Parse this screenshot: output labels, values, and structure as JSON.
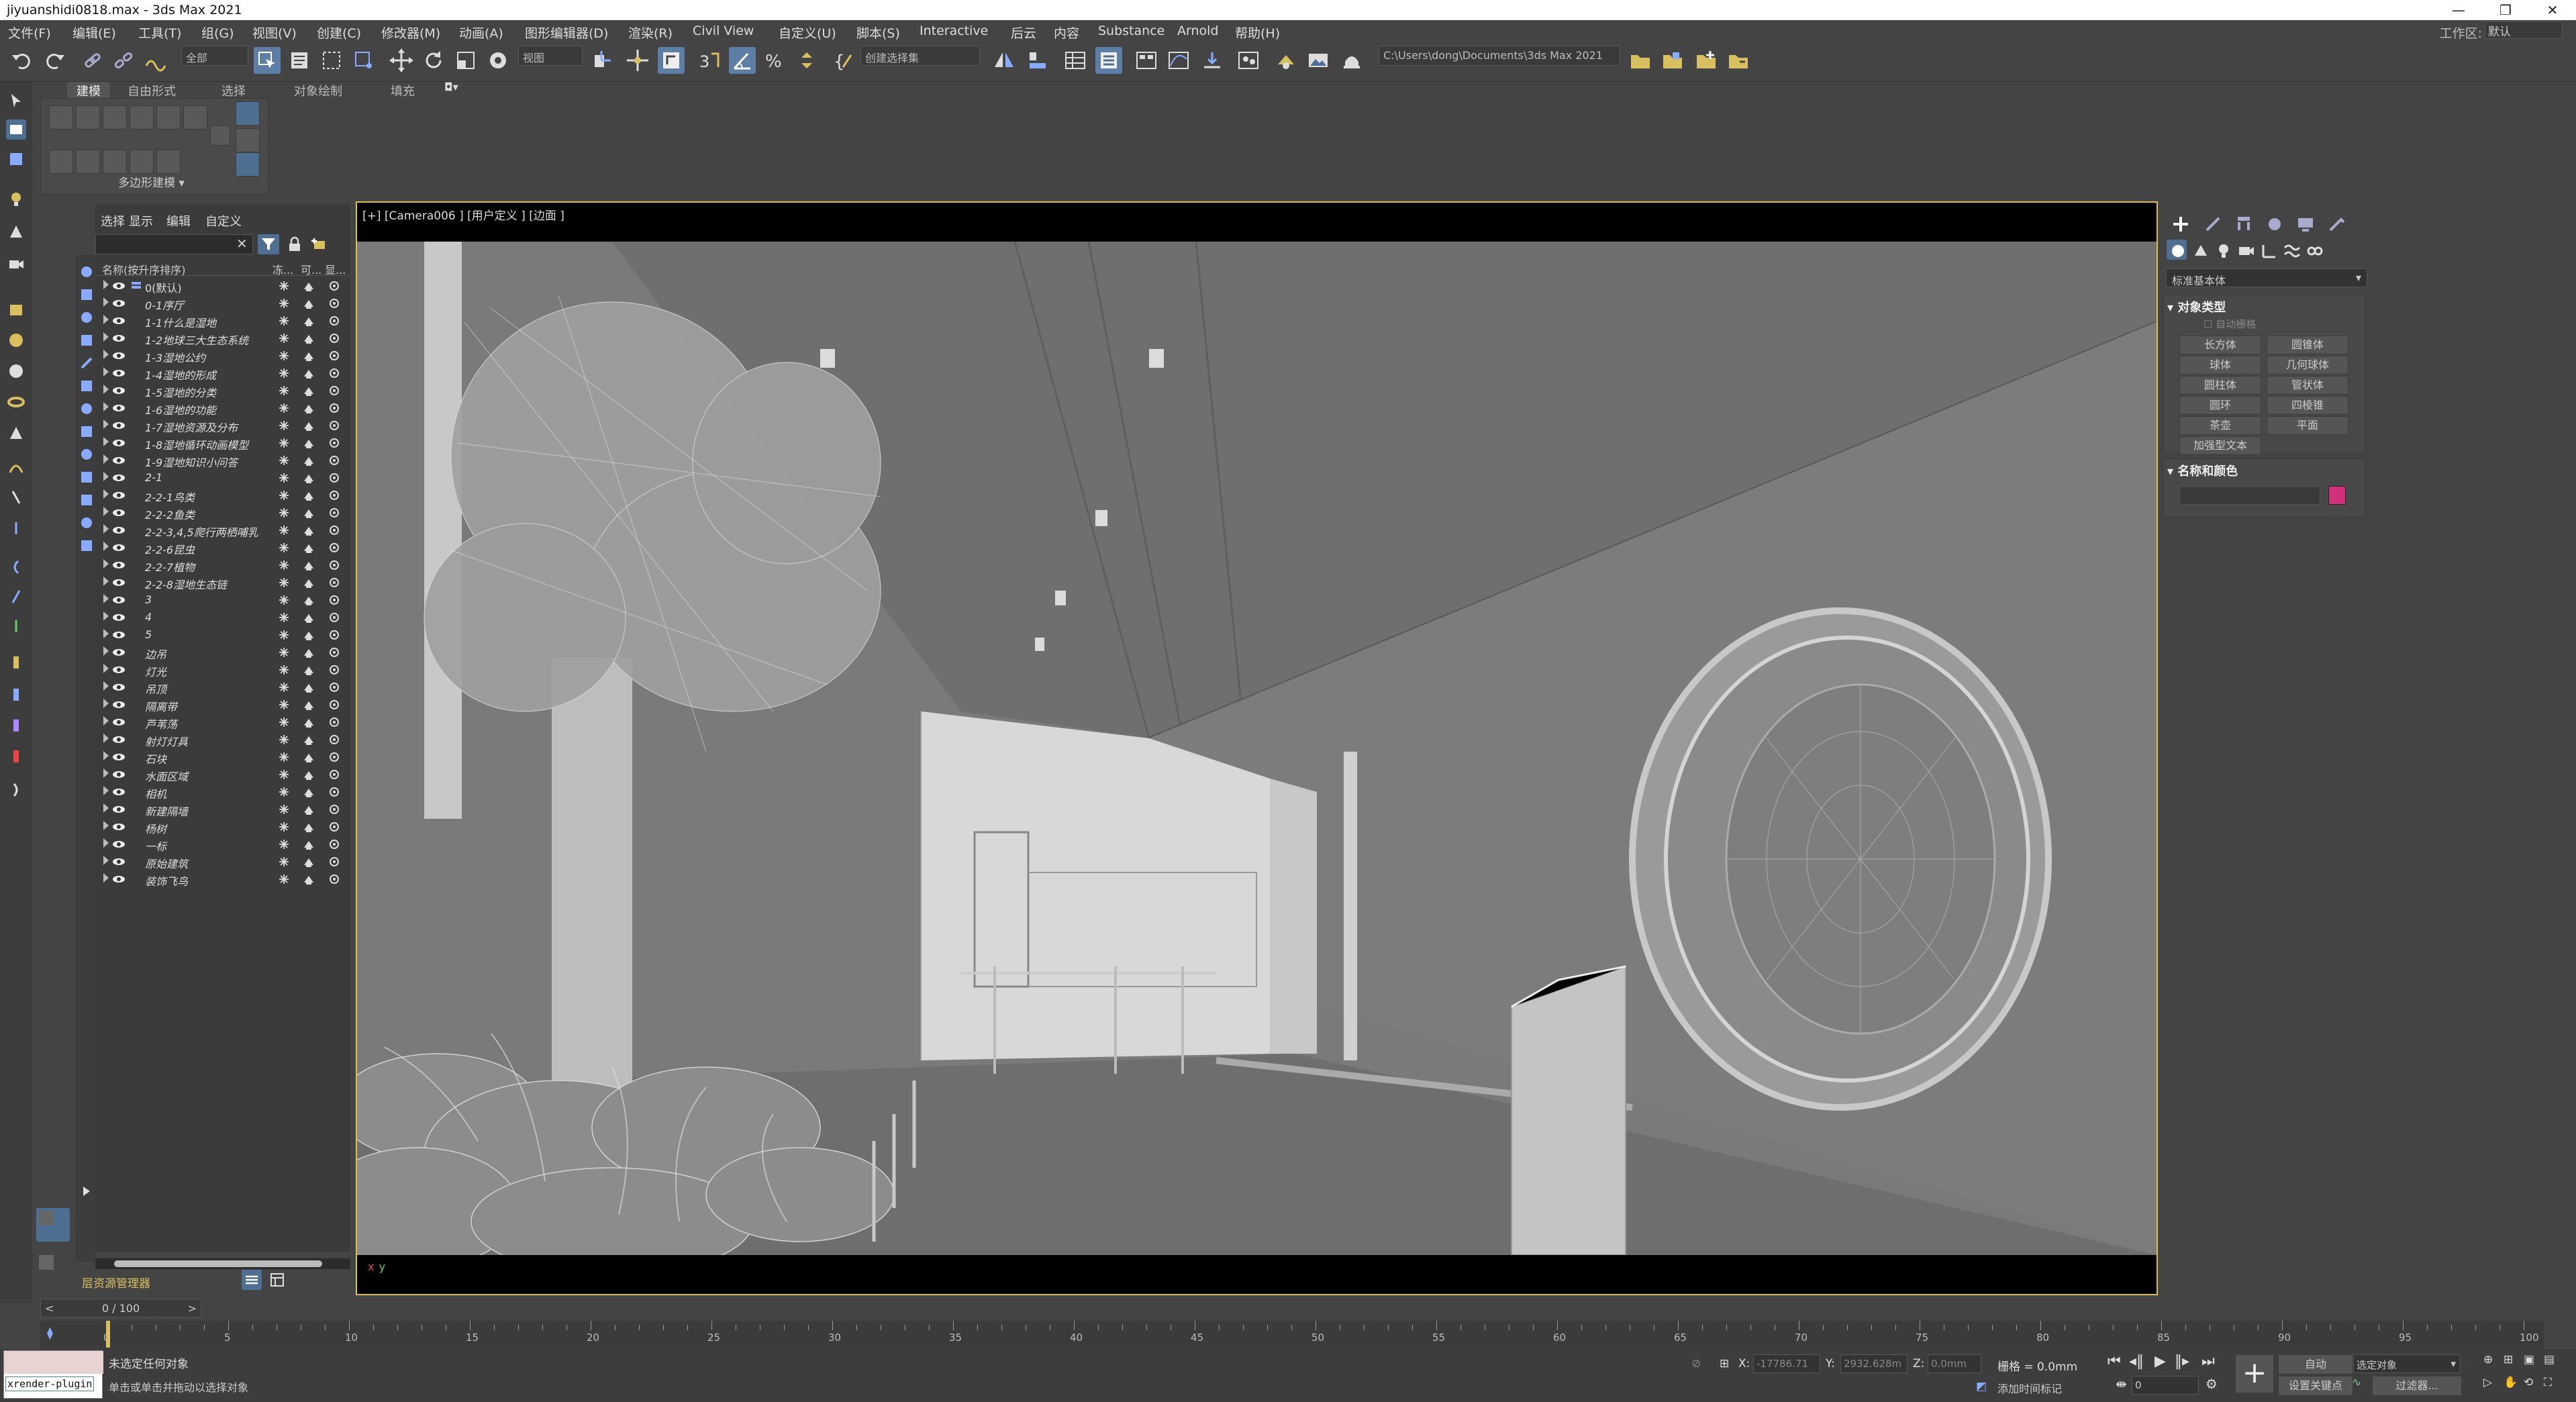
{
  "window": {
    "title": "jiyuanshidi0818.max - 3ds Max 2021",
    "minimize": "—",
    "restore": "❐",
    "close": "✕"
  },
  "menu": {
    "items": [
      "文件(F)",
      "编辑(E)",
      "工具(T)",
      "组(G)",
      "视图(V)",
      "创建(C)",
      "修改器(M)",
      "动画(A)",
      "图形编辑器(D)",
      "渲染(R)",
      "Civil View",
      "自定义(U)",
      "脚本(S)",
      "Interactive",
      "后云",
      "内容",
      "Substance",
      "Arnold",
      "帮助(H)"
    ],
    "workspace_label": "工作区:",
    "workspace_value": "默认"
  },
  "toolbar": {
    "filter_value": "全部",
    "refcoord_value": "视图",
    "selection_set": "创建选择集",
    "project_path": "C:\\Users\\dong\\Documents\\3ds Max 2021"
  },
  "ribbon": {
    "tabs": [
      "建模",
      "自由形式",
      "选择",
      "对象绘制",
      "填充"
    ],
    "panel_label": "多边形建模 ▾"
  },
  "explorer": {
    "menu": [
      "选择",
      "显示",
      "编辑",
      "自定义"
    ],
    "header": {
      "name_col": "名称(按升序排序)",
      "col1": "冻...",
      "col2": "可...",
      "col3": "显..."
    },
    "rows": [
      "0(默认)",
      "0-1序厅",
      "1-1什么是湿地",
      "1-2地球三大生态系统",
      "1-3湿地公约",
      "1-4湿地的形成",
      "1-5湿地的分类",
      "1-6湿地的功能",
      "1-7湿地资源及分布",
      "1-8湿地循环动画模型",
      "1-9湿地知识小问答",
      "2-1",
      "2-2-1鸟类",
      "2-2-2鱼类",
      "2-2-3,4,5爬行两栖哺乳",
      "2-2-6昆虫",
      "2-2-7植物",
      "2-2-8湿地生态链",
      "3",
      "4",
      "5",
      "边吊",
      "灯光",
      "吊顶",
      "隔离带",
      "芦苇荡",
      "射灯灯具",
      "石块",
      "水面区域",
      "相机",
      "新建隔墙",
      "杨树",
      "一标",
      "原始建筑",
      "装饰飞鸟"
    ],
    "footer_label": "层资源管理器"
  },
  "viewport": {
    "label": "[+] [Camera006 ] [用户定义 ] [边面 ]",
    "axis_x": "x",
    "axis_y": "y"
  },
  "command_panel": {
    "category_dropdown": "标准基本体",
    "rollout_object_type": "对象类型",
    "autogrid": "自动栅格",
    "buttons": [
      "长方体",
      "圆锥体",
      "球体",
      "几何球体",
      "圆柱体",
      "管状体",
      "圆环",
      "四棱锥",
      "茶壶",
      "平面",
      "加强型文本"
    ],
    "rollout_name_color": "名称和颜色",
    "object_color": "#d1317a"
  },
  "timeline": {
    "slider": "0 / 100",
    "ticks": [
      "0",
      "5",
      "10",
      "15",
      "20",
      "25",
      "30",
      "35",
      "40",
      "45",
      "50",
      "55",
      "60",
      "65",
      "70",
      "75",
      "80",
      "85",
      "90",
      "95",
      "100"
    ]
  },
  "status": {
    "maxscript": "xrender-plugin",
    "line1": "未选定任何对象",
    "line2": "单击或单击并拖动以选择对象",
    "x_label": "X:",
    "x_value": "-17786.71",
    "y_label": "Y:",
    "y_value": "2932.628m",
    "z_label": "Z:",
    "z_value": "0.0mm",
    "grid": "栅格 = 0.0mm",
    "add_time_tag": "添加时间标记",
    "auto_key": "自动",
    "set_key": "设置关键点",
    "selected_object": "选定对象",
    "key_filters": "过滤器...",
    "frame_value": "0"
  }
}
